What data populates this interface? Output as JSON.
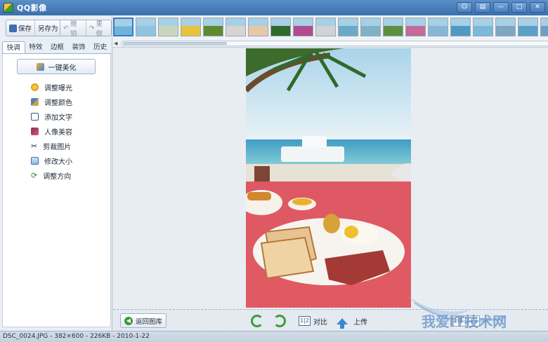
{
  "window": {
    "title": "QQ影像",
    "controls": [
      "restore",
      "menu",
      "minimize",
      "maximize",
      "close"
    ]
  },
  "toolbar": {
    "save": "保存",
    "save_as": "另存为",
    "undo": "撤销",
    "redo": "重做"
  },
  "tabs": [
    {
      "label": "快调",
      "active": true
    },
    {
      "label": "特效"
    },
    {
      "label": "边框"
    },
    {
      "label": "装饰"
    },
    {
      "label": "历史"
    }
  ],
  "quick": {
    "one_key": "一键美化",
    "items": [
      {
        "label": "调整曝光",
        "icon": "sun-icon"
      },
      {
        "label": "调整颜色",
        "icon": "palette-icon"
      },
      {
        "label": "添加文字",
        "icon": "text-icon"
      },
      {
        "label": "人像美容",
        "icon": "portrait-icon"
      },
      {
        "label": "剪裁图片",
        "icon": "scissors-icon"
      },
      {
        "label": "修改大小",
        "icon": "resize-icon"
      },
      {
        "label": "调整方向",
        "icon": "rotate-icon"
      }
    ]
  },
  "filmstrip": {
    "thumbs": [
      "#6fb4d8",
      "#8fc4e0",
      "#c9d6bc",
      "#e9c23b",
      "#5e8a2e",
      "#d8d3cf",
      "#e6c8a8",
      "#2f6a2a",
      "#b14b8f",
      "#cfd3d6",
      "#6ba9c9",
      "#7fb2c4",
      "#5c8f3f",
      "#c46b9a",
      "#88b6d9",
      "#4e9ac2",
      "#7cb8d8",
      "#7fa6bf",
      "#5aa0c9",
      "#6d9ec4"
    ]
  },
  "bottom": {
    "back": "返回图库",
    "compare": "对比",
    "upload": "上传",
    "compare_icon": "1|2",
    "zoom": "1:1"
  },
  "status": {
    "text": "DSC_0024.JPG - 382×600 - 226KB - 2010-1-22"
  },
  "watermark": {
    "text": "我爱IT技术网"
  }
}
